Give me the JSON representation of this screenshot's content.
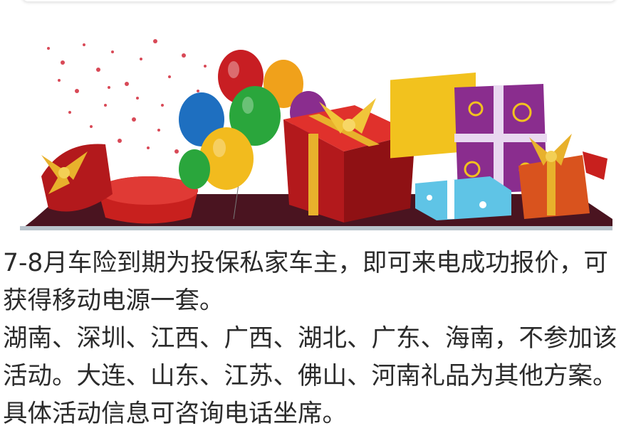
{
  "banner": {
    "image": "gift-boxes-balloons-illustration"
  },
  "content": {
    "paragraph1": "7-8月车险到期为投保私家车主，即可来电成功报价，可获得移动电源一套。",
    "paragraph2": "湖南、深圳、江西、广西、湖北、广东、海南，不参加该活动。大连、山东、江苏、佛山、河南礼品为其他方案。具体活动信息可咨询电话坐席。"
  },
  "colors": {
    "text": "#2b2b2b",
    "gift_red": "#c8201e",
    "gold": "#e8b12c",
    "purple": "#8a2d8e"
  }
}
